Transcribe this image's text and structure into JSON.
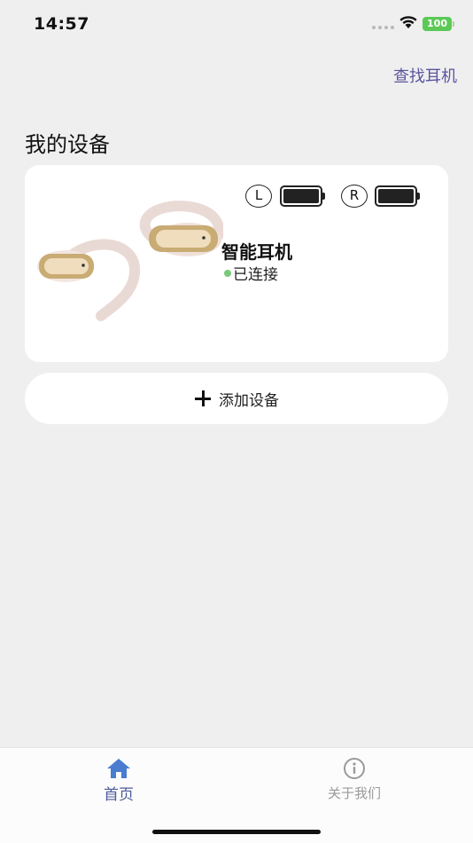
{
  "status_bar": {
    "time": "14:57",
    "battery": "100",
    "battery_color": "#5cc957"
  },
  "header": {
    "find_label": "查找耳机"
  },
  "section": {
    "title": "我的设备"
  },
  "device": {
    "name": "智能耳机",
    "status": "已连接",
    "status_color": "#7ac97a",
    "left_label": "L",
    "right_label": "R",
    "left_battery_level": 1.0,
    "right_battery_level": 1.0
  },
  "add_button": {
    "label": "添加设备"
  },
  "tabs": [
    {
      "label": "首页",
      "icon": "home-icon",
      "active": true,
      "color": "#4a7cd0"
    },
    {
      "label": "关于我们",
      "icon": "info-icon",
      "active": false,
      "color": "#9a9a9a"
    }
  ]
}
